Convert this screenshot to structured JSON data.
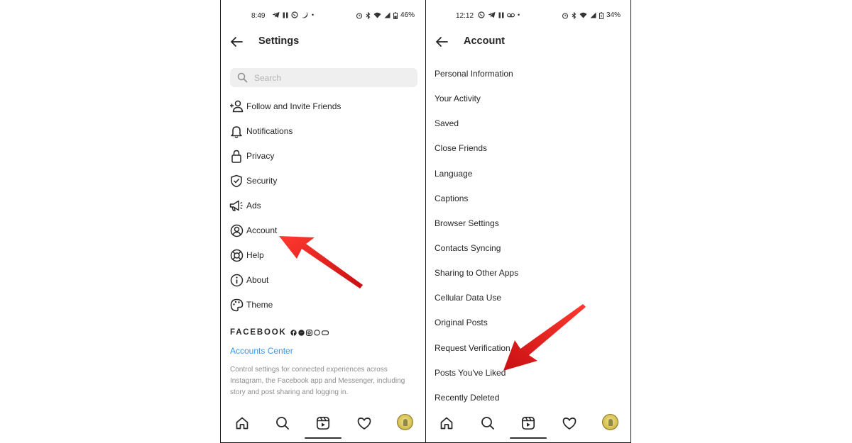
{
  "left_phone": {
    "status": {
      "time": "8:49",
      "battery": "46%"
    },
    "header": {
      "title": "Settings"
    },
    "search": {
      "placeholder": "Search"
    },
    "menu": [
      {
        "label": "Follow and Invite Friends",
        "icon": "add-person-icon"
      },
      {
        "label": "Notifications",
        "icon": "bell-icon"
      },
      {
        "label": "Privacy",
        "icon": "lock-icon"
      },
      {
        "label": "Security",
        "icon": "shield-check-icon"
      },
      {
        "label": "Ads",
        "icon": "megaphone-icon"
      },
      {
        "label": "Account",
        "icon": "account-circle-icon"
      },
      {
        "label": "Help",
        "icon": "lifebuoy-icon"
      },
      {
        "label": "About",
        "icon": "info-icon"
      },
      {
        "label": "Theme",
        "icon": "palette-icon"
      }
    ],
    "facebook": {
      "brand": "FACEBOOK",
      "accounts_center": "Accounts Center",
      "description": "Control settings for connected experiences across Instagram, the Facebook app and Messenger, including story and post sharing and logging in."
    }
  },
  "right_phone": {
    "status": {
      "time": "12:12",
      "battery": "34%"
    },
    "header": {
      "title": "Account"
    },
    "items": [
      "Personal Information",
      "Your Activity",
      "Saved",
      "Close Friends",
      "Language",
      "Captions",
      "Browser Settings",
      "Contacts Syncing",
      "Sharing to Other Apps",
      "Cellular Data Use",
      "Original Posts",
      "Request Verification",
      "Posts You've Liked",
      "Recently Deleted"
    ]
  },
  "bottom_nav": [
    "home-icon",
    "search-icon",
    "reels-icon",
    "heart-icon",
    "profile-avatar"
  ],
  "colors": {
    "accent_link": "#3897f0",
    "annotation_arrow": "#e3161b",
    "text": "#262626",
    "muted": "#8e8e8e"
  }
}
